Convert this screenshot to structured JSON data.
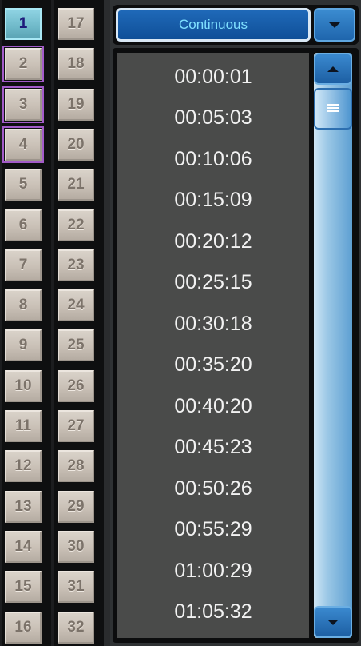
{
  "channels": {
    "left": [
      "1",
      "2",
      "3",
      "4",
      "5",
      "6",
      "7",
      "8",
      "9",
      "10",
      "11",
      "12",
      "13",
      "14",
      "15",
      "16"
    ],
    "right": [
      "17",
      "18",
      "19",
      "20",
      "21",
      "22",
      "23",
      "24",
      "25",
      "26",
      "27",
      "28",
      "29",
      "30",
      "31",
      "32"
    ],
    "selected": "1",
    "highlighted": [
      "2",
      "3",
      "4"
    ]
  },
  "mode": {
    "value": "Continuous"
  },
  "times": [
    "00:00:01",
    "00:05:03",
    "00:10:06",
    "00:15:09",
    "00:20:12",
    "00:25:15",
    "00:30:18",
    "00:35:20",
    "00:40:20",
    "00:45:23",
    "00:50:26",
    "00:55:29",
    "01:00:29",
    "01:05:32"
  ],
  "icons": {
    "dropdown": "chevron-down-icon",
    "scroll_up": "arrow-up-icon",
    "scroll_down": "arrow-down-icon",
    "thumb": "grip-icon"
  },
  "colors": {
    "selected_channel": "#6fb9c9",
    "highlight_outline": "#a35bc9",
    "dropdown_bg": "#0f4f98",
    "dropdown_text": "#7fe0ff",
    "list_bg": "#4a4b4a"
  }
}
